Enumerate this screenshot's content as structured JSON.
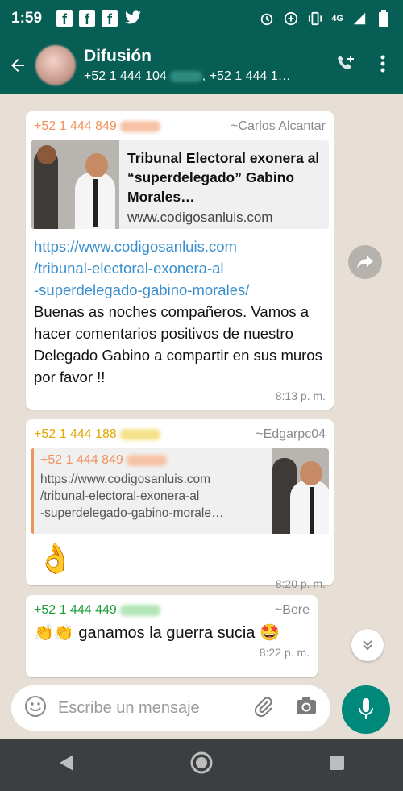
{
  "status_bar": {
    "time": "1:59",
    "network": "4G"
  },
  "header": {
    "title": "Difusión",
    "subtitle_a": "+52 1 444 104",
    "subtitle_b": ", +52 1 444 1…"
  },
  "messages": [
    {
      "sender": "+52 1 444 849",
      "sender_color": "#f0925c",
      "alias": "~Carlos Alcantar",
      "preview_title": "Tribunal Electoral exonera al “superdelegado” Gabino Morales…",
      "preview_domain": "www.codigosanluis.com",
      "link_1": "https://www.codigosanluis.com",
      "link_2": "/tribunal-electoral-exonera-al",
      "link_3": "-superdelegado-gabino-morales/",
      "text": "Buenas as noches compañeros. Vamos a hacer comentarios positivos de nuestro Delegado Gabino  a compartir en sus muros por favor !!",
      "time": "8:13 p. m."
    },
    {
      "sender": "+52 1 444 188",
      "sender_color": "#e0a800",
      "alias": "~Edgarpc04",
      "quote_sender": "+52 1 444 849",
      "quote_line_1": "https://www.codigosanluis.com",
      "quote_line_2": "/tribunal-electoral-exonera-al",
      "quote_line_3": "-superdelegado-gabino-morale…",
      "emoji": "👌",
      "time": "8:20 p. m."
    },
    {
      "sender": "+52 1 444 449",
      "sender_color": "#1e9e3a",
      "alias": "~Bere",
      "emoji_prefix": "👏👏",
      "text": "ganamos la guerra sucia",
      "emoji_suffix": "🤩",
      "time": "8:22 p. m."
    }
  ],
  "input": {
    "placeholder": "Escribe un mensaje"
  },
  "colors": {
    "header": "#075e54",
    "mic_button": "#00897b",
    "link": "#3a8fce"
  },
  "icons": [
    "back-arrow-icon",
    "add-call-icon",
    "more-options-icon",
    "forward-icon",
    "scroll-down-icon",
    "emoji-icon",
    "attach-icon",
    "camera-icon",
    "mic-icon",
    "nav-back-icon",
    "nav-home-icon",
    "nav-recents-icon"
  ]
}
